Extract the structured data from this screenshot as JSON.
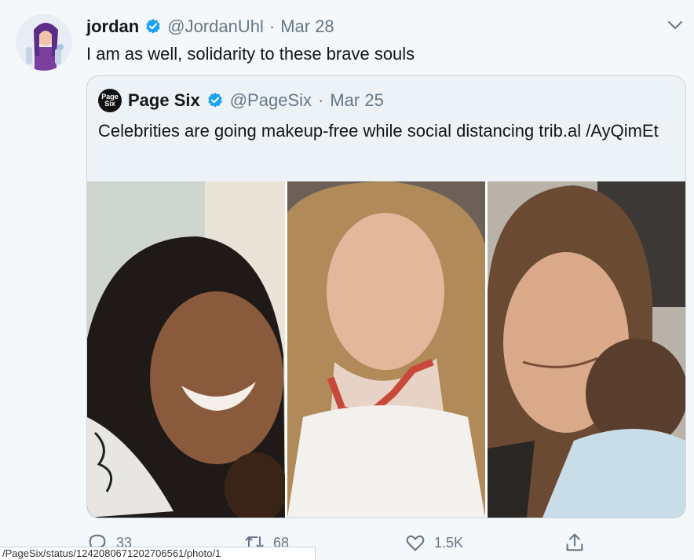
{
  "tweet": {
    "name": "jordan",
    "handle": "@JordanUhl",
    "separator": "·",
    "date": "Mar 28",
    "text": "I am as well, solidarity to these brave souls"
  },
  "quoted": {
    "logo_text_1": "Page",
    "logo_text_2": "Six",
    "name": "Page Six",
    "handle": "@PageSix",
    "separator": "·",
    "date": "Mar 25",
    "text": "Celebrities are going makeup-free while social distancing trib.al /AyQimEt"
  },
  "actions": {
    "replies": "33",
    "retweets": "68",
    "likes": "1.5K"
  },
  "status_bar": {
    "url": "/PageSix/status/1242080671202706561/photo/1"
  },
  "colors": {
    "verified": "#1da1f2",
    "muted": "#657786",
    "border": "#ccd6dd"
  },
  "icons": [
    "verified-badge-icon",
    "chevron-down-icon",
    "reply-icon",
    "retweet-icon",
    "like-icon",
    "share-icon"
  ]
}
